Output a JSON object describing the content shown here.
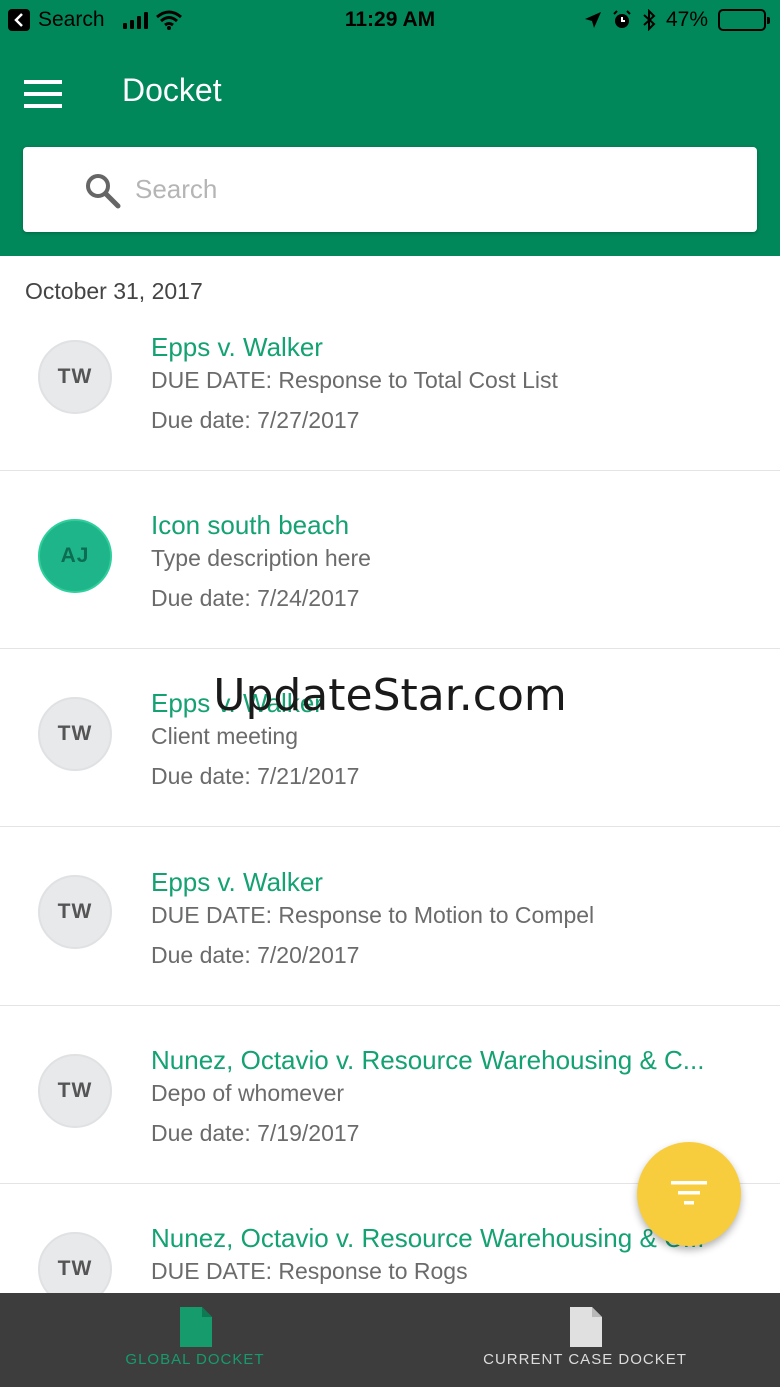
{
  "status_bar": {
    "back_label": "Search",
    "time": "11:29 AM",
    "battery": "47%",
    "battery_level": 0.47
  },
  "header": {
    "title": "Docket",
    "search_placeholder": "Search"
  },
  "list": {
    "date_header": "October 31, 2017",
    "items": [
      {
        "initials": "TW",
        "title": "Epps v. Walker",
        "description": "DUE DATE: Response to Total Cost List",
        "due": "Due date: 7/27/2017",
        "active": false
      },
      {
        "initials": "AJ",
        "title": "Icon south beach",
        "description": "Type description here",
        "due": "Due date: 7/24/2017",
        "active": true
      },
      {
        "initials": "TW",
        "title": "Epps v. Walker",
        "description": "Client meeting",
        "due": "Due date: 7/21/2017",
        "active": false
      },
      {
        "initials": "TW",
        "title": "Epps v. Walker",
        "description": "DUE DATE: Response to Motion to Compel",
        "due": "Due date: 7/20/2017",
        "active": false
      },
      {
        "initials": "TW",
        "title": "Nunez, Octavio v. Resource Warehousing & C...",
        "description": "Depo of whomever",
        "due": "Due date: 7/19/2017",
        "active": false
      },
      {
        "initials": "TW",
        "title": "Nunez, Octavio v. Resource Warehousing & C...",
        "description": "DUE DATE: Response to Rogs",
        "due": "",
        "active": false
      }
    ]
  },
  "watermark": "UpdateStar.com",
  "bottom_nav": {
    "global_label": "GLOBAL DOCKET",
    "current_label": "CURRENT CASE DOCKET"
  },
  "colors": {
    "brand_green": "#00875a",
    "accent_text": "#14a173",
    "fab_yellow": "#f8cd3d",
    "nav_bg": "#3d3d3d"
  }
}
